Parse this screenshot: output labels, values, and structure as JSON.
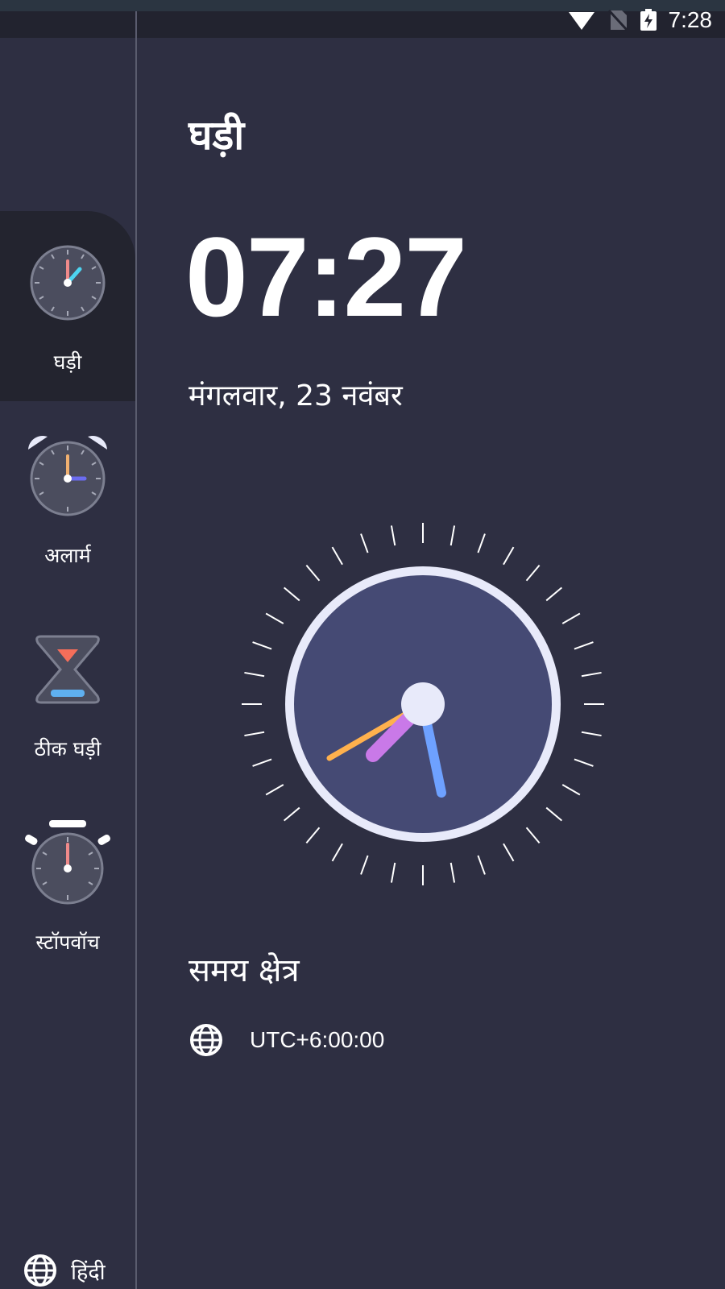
{
  "status_bar": {
    "time": "7:28",
    "icons": [
      "wifi-icon",
      "no-sim-icon",
      "battery-charging-icon"
    ]
  },
  "sidebar": {
    "items": [
      {
        "label": "घड़ी",
        "icon": "clock-icon",
        "active": true
      },
      {
        "label": "अलार्म",
        "icon": "alarm-clock-icon",
        "active": false
      },
      {
        "label": "ठीक घड़ी",
        "icon": "hourglass-icon",
        "active": false
      },
      {
        "label": "स्टॉपवॉच",
        "icon": "stopwatch-icon",
        "active": false
      }
    ],
    "language": {
      "label": "हिंदी",
      "icon": "globe-icon"
    }
  },
  "main": {
    "title": "घड़ी",
    "digital_time": "07:27",
    "date": "मंगलवार, 23 नवंबर",
    "timezone_section_title": "समय क्षेत्र",
    "timezone": "UTC+6:00:00"
  },
  "colors": {
    "background": "#2e2f42",
    "sidebar_active": "#23242f",
    "clock_face": "#454a74",
    "clock_rim": "#e8eafa",
    "hour_hand": "#6ea1ff",
    "minute_hand": "#ffb14d",
    "second_hand": "#c979e8"
  }
}
